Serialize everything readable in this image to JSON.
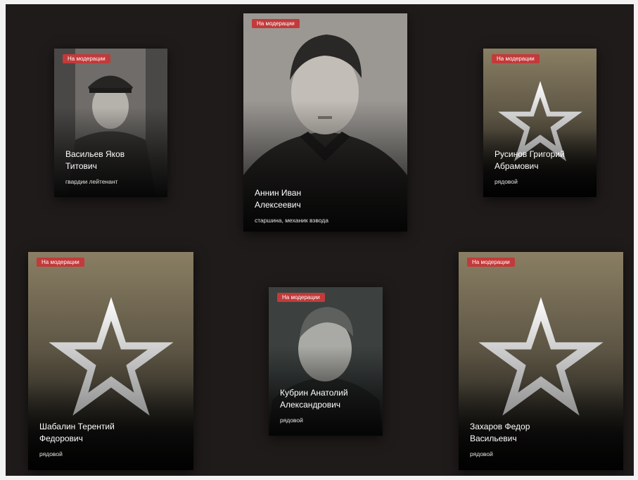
{
  "badge_label": "На модерации",
  "colors": {
    "badge": "#c23a3a",
    "background": "#1f1b1a",
    "star_card_top": "#8a7f64"
  },
  "cards": [
    {
      "image": "portrait-photo",
      "name_line1": "Васильев Яков",
      "name_line2": "Титович",
      "rank": "гвардии лейтенант"
    },
    {
      "image": "portrait-photo",
      "name_line1": "Аннин Иван",
      "name_line2": "Алексеевич",
      "rank": "старшина, механик взвода"
    },
    {
      "image": "army-star-icon",
      "name_line1": "Русинов Григорий",
      "name_line2": "Абрамович",
      "rank": "рядовой"
    },
    {
      "image": "army-star-icon",
      "name_line1": "Шабалин Терентий",
      "name_line2": "Федорович",
      "rank": "рядовой"
    },
    {
      "image": "portrait-photo",
      "name_line1": "Кубрин Анатолий",
      "name_line2": "Александрович",
      "rank": "рядовой"
    },
    {
      "image": "army-star-icon",
      "name_line1": "Захаров Федор",
      "name_line2": "Васильевич",
      "rank": "рядовой"
    }
  ]
}
